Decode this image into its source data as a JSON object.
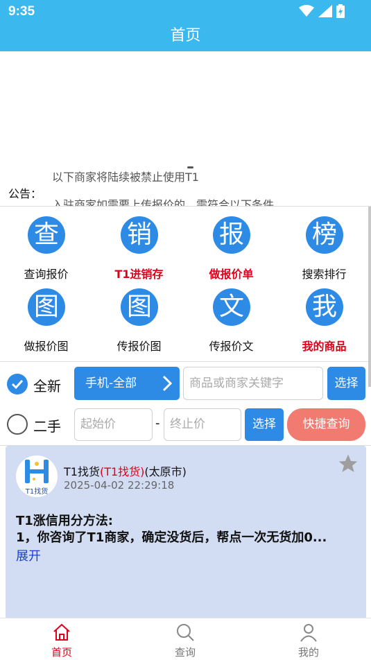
{
  "status": {
    "time": "9:35"
  },
  "header": {
    "title": "首页"
  },
  "notice": {
    "label": "公告：",
    "lines": [
      "以下商家将陆续被禁止使用T1",
      "入驻商家如需要上传报价的，需符合以下条件"
    ]
  },
  "grid": [
    {
      "glyph": "查",
      "label": "查询报价",
      "highlight": false
    },
    {
      "glyph": "销",
      "label": "T1进销存",
      "highlight": true
    },
    {
      "glyph": "报",
      "label": "做报价单",
      "highlight": true
    },
    {
      "glyph": "榜",
      "label": "搜索排行",
      "highlight": false
    },
    {
      "glyph": "图",
      "label": "做报价图",
      "highlight": false
    },
    {
      "glyph": "图",
      "label": "传报价图",
      "highlight": false
    },
    {
      "glyph": "文",
      "label": "传报价文",
      "highlight": false
    },
    {
      "glyph": "我",
      "label": "我的商品",
      "highlight": true
    }
  ],
  "filters": {
    "new_label": "全新",
    "used_label": "二手",
    "category": "手机-全部",
    "keyword_placeholder": "商品或商家关键字",
    "select_label": "选择",
    "min_price_placeholder": "起始价",
    "dash": "-",
    "max_price_placeholder": "终止价",
    "select2_label": "选择",
    "quick_query": "快捷查询"
  },
  "post": {
    "shop_name": "T1找货",
    "shop_tag": "(T1找货)",
    "city": "(太原市)",
    "datetime": "2025-04-02 22:29:18",
    "logo_text": "T1找货",
    "title": "T1涨信用分方法:",
    "content": "1，你咨询了T1商家，确定没货后，帮点一次无货加0...",
    "expand": "展开"
  },
  "tabs": [
    {
      "label": "首页",
      "active": true
    },
    {
      "label": "查询",
      "active": false
    },
    {
      "label": "我的",
      "active": false
    }
  ],
  "colors": {
    "primary": "#3bb8ee",
    "accent_blue": "#2d8be6",
    "red": "#e0001b",
    "coral": "#f27b71",
    "card_bg": "#d2ddf3"
  }
}
